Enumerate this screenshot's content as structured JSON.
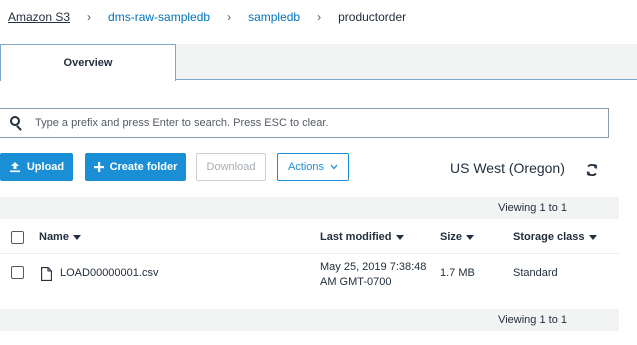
{
  "breadcrumb": {
    "items": [
      "Amazon S3",
      "dms-raw-sampledb",
      "sampledb"
    ],
    "current": "productorder",
    "separator": "›"
  },
  "tabs": [
    {
      "label": "Overview"
    }
  ],
  "search": {
    "placeholder": "Type a prefix and press Enter to search. Press ESC to clear."
  },
  "toolbar": {
    "upload_label": "Upload",
    "create_folder_label": "Create folder",
    "download_label": "Download",
    "actions_label": "Actions"
  },
  "region": "US West (Oregon)",
  "pagination": {
    "top": "Viewing 1 to 1",
    "bottom": "Viewing 1 to 1"
  },
  "table": {
    "columns": [
      "Name",
      "Last modified",
      "Size",
      "Storage class"
    ],
    "rows": [
      {
        "name": "LOAD00000001.csv",
        "last_modified_line1": "May 25, 2019 7:38:48",
        "last_modified_line2": "AM GMT-0700",
        "size": "1.7 MB",
        "storage_class": "Standard"
      }
    ]
  },
  "colors": {
    "accent": "#1a8fd6",
    "link": "#0073bb",
    "bar_bg": "#f2f3f3"
  }
}
